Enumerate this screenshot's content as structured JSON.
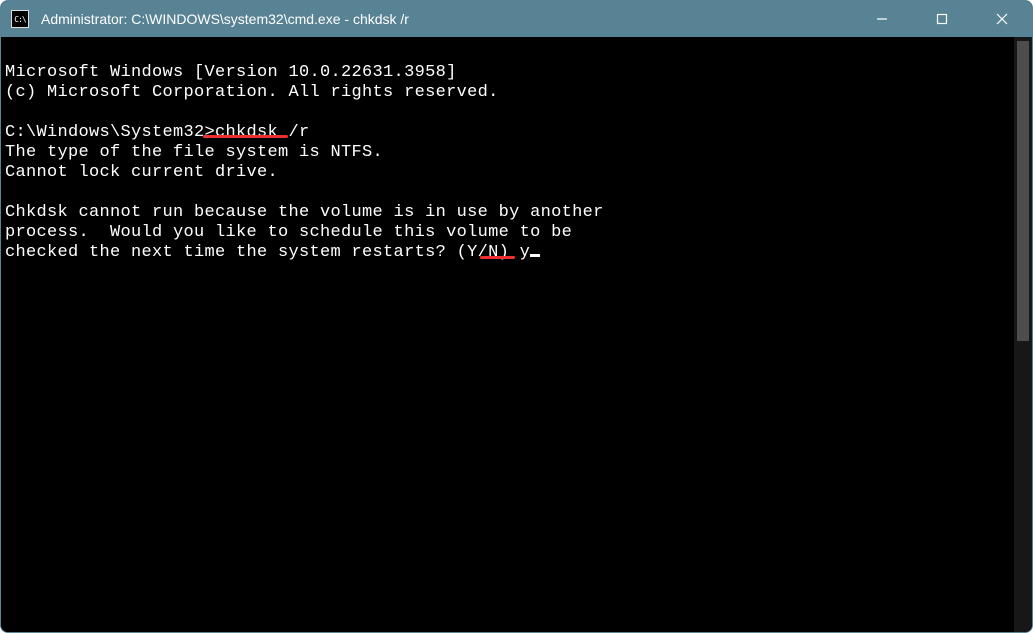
{
  "window": {
    "title": "Administrator: C:\\WINDOWS\\system32\\cmd.exe - chkdsk  /r",
    "icon_label": "C:\\"
  },
  "console": {
    "line1": "Microsoft Windows [Version 10.0.22631.3958]",
    "line2": "(c) Microsoft Corporation. All rights reserved.",
    "line3": "",
    "line4_prompt": "C:\\Windows\\System32>",
    "line4_cmd": "chkdsk /r",
    "line5": "The type of the file system is NTFS.",
    "line6": "Cannot lock current drive.",
    "line7": "",
    "line8": "Chkdsk cannot run because the volume is in use by another",
    "line9": "process.  Would you like to schedule this volume to be",
    "line10_prompt": "checked the next time the system restarts? (Y/N) ",
    "line10_input": "y"
  }
}
